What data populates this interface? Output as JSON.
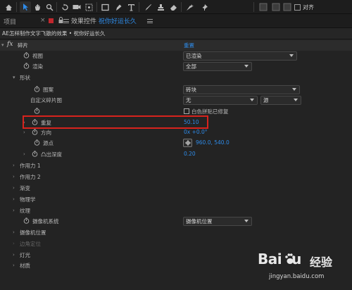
{
  "toolbar": {
    "tools": [
      "home-icon",
      "selection-icon",
      "hand-icon",
      "zoom-icon",
      "rotate-icon",
      "camera-icon",
      "pan-behind-icon",
      "rectangle-icon",
      "pen-icon",
      "type-icon",
      "brush-icon",
      "clone-stamp-icon",
      "eraser-icon",
      "roto-brush-icon",
      "puppet-pin-icon"
    ],
    "align_label": "对齐"
  },
  "tabs": {
    "project": "项目",
    "close_glyph": "×",
    "effect_controls_prefix": "效果控件",
    "effect_controls_comp": "祝你好运长久"
  },
  "breadcrumb": "AE怎样制作文字飞散的效果 • 祝你好运长久",
  "rows": [
    {
      "id": "fx",
      "arrow": "▾",
      "label": "碎片",
      "reset": "重置"
    },
    {
      "id": "view",
      "label": "视图",
      "value": "已渲染"
    },
    {
      "id": "render",
      "label": "渲染",
      "value": "全部"
    },
    {
      "id": "shape",
      "arrow": "▾",
      "label": "形状"
    },
    {
      "id": "pattern",
      "label": "图案",
      "value": "砖块"
    },
    {
      "id": "custom",
      "label": "自定义碎片图",
      "value": "无",
      "value2": "源"
    },
    {
      "id": "white",
      "label": "",
      "checkbox_label": "白色拼贴已修复"
    },
    {
      "id": "repeat",
      "arrow": "›",
      "label": "重复",
      "value": "50.10"
    },
    {
      "id": "direction",
      "arrow": "›",
      "label": "方向",
      "value": "0x +0.0°"
    },
    {
      "id": "origin",
      "label": "源点",
      "value": "960.0, 540.0"
    },
    {
      "id": "extrude",
      "arrow": "›",
      "label": "凸出深度",
      "value": "0.20"
    },
    {
      "id": "force1",
      "arrow": "›",
      "label": "作用力 1"
    },
    {
      "id": "force2",
      "arrow": "›",
      "label": "作用力 2"
    },
    {
      "id": "gradient",
      "arrow": "›",
      "label": "渐变"
    },
    {
      "id": "physics",
      "arrow": "›",
      "label": "物理学"
    },
    {
      "id": "texture",
      "arrow": "›",
      "label": "纹理"
    },
    {
      "id": "camera_sys",
      "label": "摄像机系统",
      "value": "摄像机位置"
    },
    {
      "id": "camera_pos",
      "arrow": "›",
      "label": "摄像机位置"
    },
    {
      "id": "corner",
      "arrow": "›",
      "label": "边角定位",
      "dim": true
    },
    {
      "id": "light",
      "arrow": "›",
      "label": "灯光"
    },
    {
      "id": "material",
      "arrow": "›",
      "label": "材质"
    }
  ],
  "watermark": {
    "logo": "Bai",
    "logo_suffix": "u",
    "cn": "经验",
    "url": "jingyan.baidu.com"
  },
  "colors": {
    "accent": "#2e8be8",
    "highlight": "#d7231d"
  }
}
